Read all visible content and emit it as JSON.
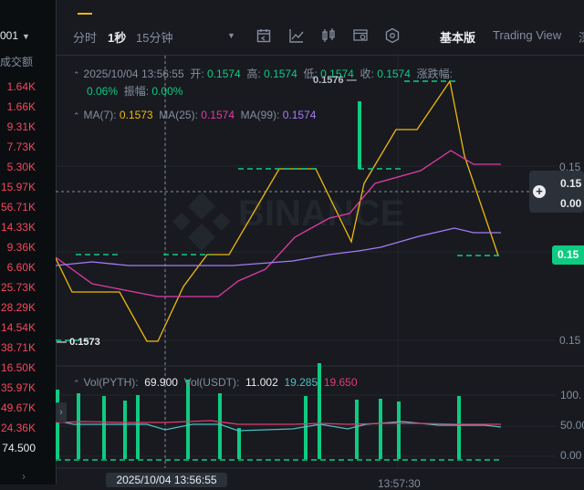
{
  "left_panel": {
    "pair_suffix": "001",
    "header": "成交额",
    "volumes": [
      "1.64K",
      "1.66K",
      "9.31K",
      "7.73K",
      "5.30K",
      "15.97K",
      "56.71K",
      "14.33K",
      "9.36K",
      "6.60K",
      "25.73K",
      "28.29K",
      "14.54K",
      "38.71K",
      "16.50K",
      "35.97K",
      "49.67K",
      "24.36K",
      "74.500"
    ]
  },
  "toolbar": {
    "intervals": [
      "分时",
      "1秒",
      "15分钟"
    ],
    "active_interval": "1秒",
    "view_basic": "基本版",
    "view_tv": "Trading View",
    "view_depth": "深"
  },
  "legend": {
    "datetime": "2025/10/04 13:56:55",
    "open_label": "开:",
    "open": "0.1574",
    "high_label": "高:",
    "high": "0.1574",
    "low_label": "低:",
    "low": "0.1574",
    "close_label": "收:",
    "close": "0.1574",
    "change_label": "涨跌幅:",
    "change": "0.06%",
    "amplitude_label": "振幅:",
    "amplitude": "0.00%",
    "ma7_label": "MA(7):",
    "ma7": "0.1573",
    "ma25_label": "MA(25):",
    "ma25": "0.1574",
    "ma99_label": "MA(99):",
    "ma99": "0.1574"
  },
  "chart_labels": {
    "high_mark": "0.1576",
    "low_mark": "0.1573",
    "watermark": "BINANCE"
  },
  "price_axis": {
    "tick_top": "0.15",
    "crosshair_value_1": "0.15",
    "crosshair_value_2": "0.00",
    "current_price": "0.15",
    "tick_bottom": "0.15"
  },
  "volume_legend": {
    "vol_pyth_label": "Vol(PYTH):",
    "vol_pyth": "69.900",
    "vol_usdt_label": "Vol(USDT):",
    "vol_usdt": "11.002",
    "vol_v2": "19.285",
    "vol_v3": "19.650"
  },
  "volume_axis": [
    "100.",
    "50.00",
    "0.00"
  ],
  "time_axis": {
    "crosshair_time": "2025/10/04 13:56:55",
    "tick": "13:57:30"
  },
  "colors": {
    "up": "#0ecb81",
    "down": "#f6465d",
    "ma7": "#f0b90b",
    "ma25": "#e13ba6",
    "ma99": "#a77bf2"
  }
}
